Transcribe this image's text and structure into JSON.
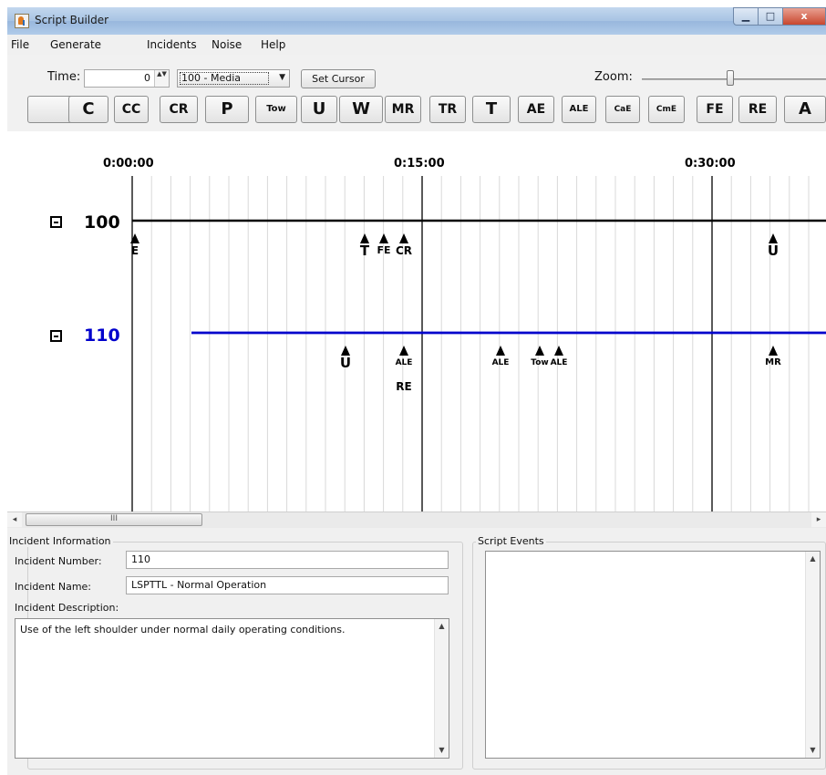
{
  "window": {
    "title": "Script Builder",
    "min_glyph": "▁",
    "max_glyph": "□",
    "close_glyph": "x",
    "icon": "java-app-icon"
  },
  "menu": [
    {
      "label": "File"
    },
    {
      "label": "Generate"
    },
    {
      "label": "Incidents"
    },
    {
      "label": "Noise"
    },
    {
      "label": "Help"
    }
  ],
  "toolbar": {
    "time_label": "Time:",
    "time_value": "0",
    "spinner_arrows": "▲▼",
    "incident_select": "100 - Media",
    "combo_arrow": "▼",
    "set_cursor_label": "Set Cursor",
    "zoom_label": "Zoom:",
    "zoom_level": 0.48
  },
  "event_buttons": [
    {
      "label": ""
    },
    {
      "label": "C"
    },
    {
      "label": "CC"
    },
    {
      "label": "CR"
    },
    {
      "label": "P"
    },
    {
      "label": "Tow"
    },
    {
      "label": "U"
    },
    {
      "label": "W"
    },
    {
      "label": "MR"
    },
    {
      "label": "TR"
    },
    {
      "label": "T"
    },
    {
      "label": "AE"
    },
    {
      "label": "ALE"
    },
    {
      "label": "CaE"
    },
    {
      "label": "CmE"
    },
    {
      "label": "FE"
    },
    {
      "label": "RE"
    },
    {
      "label": "A"
    }
  ],
  "timeline": {
    "time_ticks": [
      "0:00:00",
      "0:15:00",
      "0:30:00"
    ],
    "tracks": [
      {
        "id": "100",
        "toggle": "−",
        "color": "#000000"
      },
      {
        "id": "110",
        "toggle": "−",
        "color": "#0000cc"
      }
    ],
    "markers_track_100": [
      {
        "label": "E"
      },
      {
        "label": "T"
      },
      {
        "label": "FE"
      },
      {
        "label": "CR"
      },
      {
        "label": "U"
      }
    ],
    "markers_track_110": [
      {
        "label": "U"
      },
      {
        "label": "ALE"
      },
      {
        "label": "RE"
      },
      {
        "label": "ALE"
      },
      {
        "label": "Tow"
      },
      {
        "label": "ALE"
      },
      {
        "label": "MR"
      }
    ]
  },
  "scrollbar": {
    "left_arrow": "◂",
    "thumb_grip": "III",
    "right_arrow": "▸"
  },
  "incident_info": {
    "group_title": "Incident Information",
    "number_label": "Incident Number:",
    "number_value": "110",
    "name_label": "Incident Name:",
    "name_value": "LSPTTL - Normal Operation",
    "description_label": "Incident Description:",
    "description_value": "Use of the left shoulder under normal daily operating conditions.",
    "scroll_up": "▲",
    "scroll_down": "▼"
  },
  "script_events": {
    "group_title": "Script Events",
    "scroll_up": "▲",
    "scroll_down": "▼"
  }
}
